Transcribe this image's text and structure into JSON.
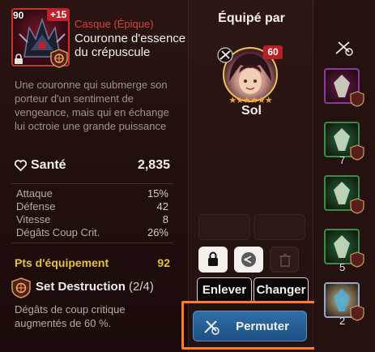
{
  "item": {
    "level": "90",
    "enhance": "+15",
    "type": "Casque (Épique)",
    "name": "Couronne d'essence du crépuscule",
    "description": "Une couronne qui submerge son porteur d'un sentiment de vengeance, mais qui en échange lui octroie une grande puissance",
    "main_stat": {
      "label": "Santé",
      "value": "2,835"
    },
    "sub_stats": [
      {
        "label": "Attaque",
        "value": "15%"
      },
      {
        "label": "Défense",
        "value": "42"
      },
      {
        "label": "Vitesse",
        "value": "8"
      },
      {
        "label": "Dégâts Coup Crit.",
        "value": "26%"
      }
    ],
    "gear_points": {
      "label": "Pts d'équipement",
      "value": "92"
    },
    "set": {
      "name": "Set Destruction",
      "count": "(2/4)",
      "description": "Dégâts de coup critique augmentés de 60 %."
    }
  },
  "equipped": {
    "title": "Équipé par",
    "hero_name": "Sol",
    "hero_level": "60",
    "stars": "★★★★★★"
  },
  "actions": {
    "remove": "Enlever",
    "change": "Changer",
    "permute": "Permuter"
  },
  "inventory": [
    {
      "color": "#6a1a4a",
      "count": ""
    },
    {
      "color": "#1f6a3a",
      "count": "7"
    },
    {
      "color": "#1f6a3a",
      "count": ""
    },
    {
      "color": "#1f6a3a",
      "count": "5"
    },
    {
      "color": "#c9b98a",
      "count": "2"
    }
  ],
  "colors": {
    "accent_red": "#d9433a",
    "gold": "#e6c33a",
    "highlight": "#ff7a2a",
    "permute_blue": "#1d4f82"
  }
}
